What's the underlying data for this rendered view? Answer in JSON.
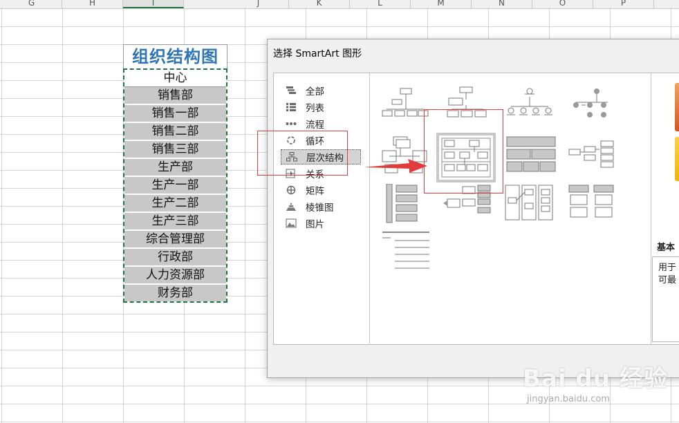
{
  "spreadsheet": {
    "columns": [
      "G",
      "H",
      "I",
      "J",
      "K",
      "L",
      "M",
      "N",
      "O",
      "P"
    ],
    "active_column": "I",
    "title_cell": "组织结构图",
    "list": [
      "中心",
      "销售部",
      "销售一部",
      "销售二部",
      "销售三部",
      "生产部",
      "生产一部",
      "生产二部",
      "生产三部",
      "综合管理部",
      "行政部",
      "人力资源部",
      "财务部"
    ],
    "accent_color": "#2e75b6",
    "selection_color": "#217346"
  },
  "dialog": {
    "title": "选择 SmartArt 图形",
    "categories": [
      {
        "label": "全部",
        "icon": "all-icon"
      },
      {
        "label": "列表",
        "icon": "list-icon"
      },
      {
        "label": "流程",
        "icon": "process-icon"
      },
      {
        "label": "循环",
        "icon": "cycle-icon"
      },
      {
        "label": "层次结构",
        "icon": "hierarchy-icon",
        "selected": true
      },
      {
        "label": "关系",
        "icon": "relationship-icon"
      },
      {
        "label": "矩阵",
        "icon": "matrix-icon"
      },
      {
        "label": "棱锥图",
        "icon": "pyramid-icon"
      },
      {
        "label": "图片",
        "icon": "picture-icon"
      }
    ],
    "preview": {
      "name": "基本",
      "description_line1": "用于",
      "description_line2": "可最"
    }
  },
  "watermark": {
    "main": "Bai du 经验",
    "sub": "jingyan.baidu.com"
  }
}
